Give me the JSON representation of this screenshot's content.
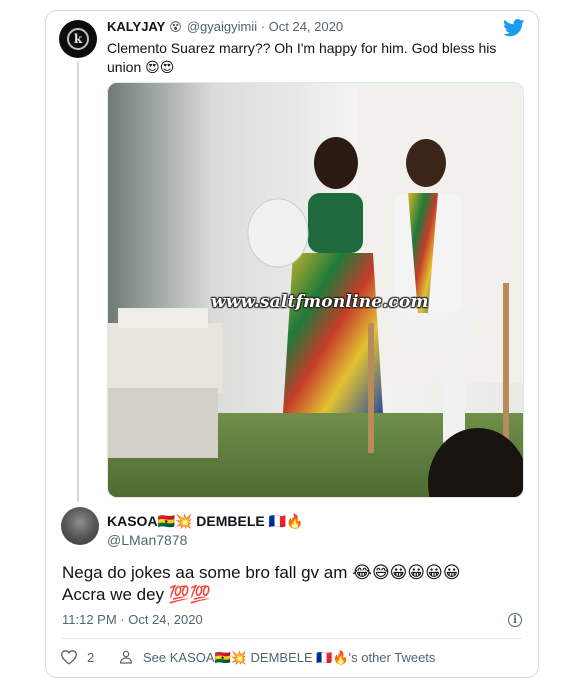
{
  "quoted": {
    "name": "KALYJAY",
    "name_emoji": "😵",
    "meta": "@gyaigyimii · Oct 24, 2020",
    "text": "Clemento Suarez marry?? Oh I'm happy for him. God bless his union 😍😍",
    "avatar_letter": "k",
    "watermark": "www.saltfmonline.com"
  },
  "tweet": {
    "name": "KASOA🇬🇭💥 DEMBELE 🇫🇷🔥",
    "handle": "@LMan7878",
    "text_line1": "Nega do jokes aa some bro fall gv am 😂😅😀😀😀😀",
    "text_line2": "Accra we dey 💯💯",
    "timestamp": "11:12 PM · Oct 24, 2020",
    "likes": "2",
    "other_tweets": "See KASOA🇬🇭💥 DEMBELE 🇫🇷🔥's other Tweets"
  },
  "colors": {
    "twitter_blue": "#1d9bf0",
    "text_primary": "#0f1419",
    "text_secondary": "#536471",
    "border": "#cfd9de"
  },
  "icons": [
    "twitter-bird-icon",
    "info-icon",
    "heart-icon",
    "person-icon"
  ]
}
